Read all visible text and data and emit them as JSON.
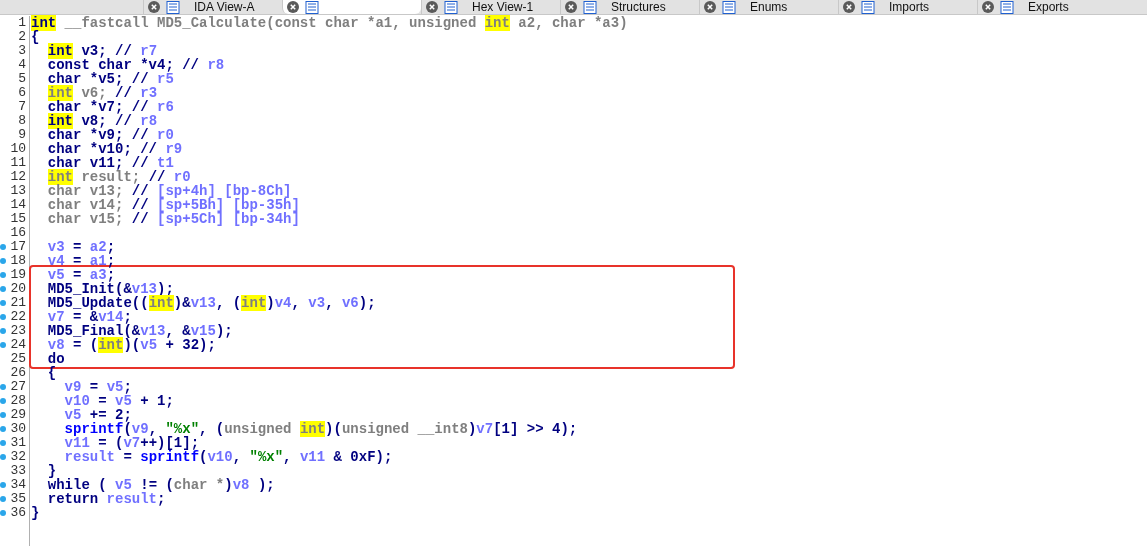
{
  "tabs": [
    {
      "label": "IDA View-A",
      "selected": false
    },
    {
      "selected": true
    },
    {
      "label": "Hex View-1",
      "selected": false
    },
    {
      "label": "Structures",
      "selected": false
    },
    {
      "label": "Enums",
      "selected": false
    },
    {
      "label": "Imports",
      "selected": false
    },
    {
      "label": "Exports",
      "selected": false
    }
  ],
  "code_lines": [
    {
      "number": "1",
      "breakpoint": false,
      "boxed": false,
      "segments": [
        {
          "kind": "hl",
          "text": "int"
        },
        {
          "kind": "dim",
          "text": " __fastcall MD5_Calculate(const char *a1, unsigned "
        },
        {
          "kind": "hldim",
          "text": "int"
        },
        {
          "kind": "dim",
          "text": " a2, char *a3)"
        }
      ]
    },
    {
      "number": "2",
      "breakpoint": false,
      "boxed": false,
      "segments": [
        {
          "kind": "code",
          "text": "{"
        }
      ],
      "children": [
        {
          "number": "3",
          "breakpoint": false,
          "boxed": false,
          "segments": [
            {
              "kind": "hl",
              "text": "int"
            },
            {
              "kind": "code",
              "text": " v3; // "
            },
            {
              "kind": "var",
              "text": "r7"
            }
          ]
        },
        {
          "number": "4",
          "breakpoint": false,
          "boxed": false,
          "segments": [
            {
              "kind": "code",
              "text": "const char *v4; // "
            },
            {
              "kind": "var",
              "text": "r8"
            }
          ]
        },
        {
          "number": "5",
          "breakpoint": false,
          "boxed": false,
          "segments": [
            {
              "kind": "code",
              "text": "char *v5; // "
            },
            {
              "kind": "var",
              "text": "r5"
            }
          ]
        },
        {
          "number": "6",
          "breakpoint": false,
          "boxed": false,
          "segments": [
            {
              "kind": "hldim",
              "text": "int"
            },
            {
              "kind": "dim",
              "text": " v6; "
            },
            {
              "kind": "code",
              "text": "// "
            },
            {
              "kind": "var",
              "text": "r3"
            }
          ]
        },
        {
          "number": "7",
          "breakpoint": false,
          "boxed": false,
          "segments": [
            {
              "kind": "code",
              "text": "char *v7; // "
            },
            {
              "kind": "var",
              "text": "r6"
            }
          ]
        },
        {
          "number": "8",
          "breakpoint": false,
          "boxed": false,
          "segments": [
            {
              "kind": "hl",
              "text": "int"
            },
            {
              "kind": "code",
              "text": " v8; // "
            },
            {
              "kind": "var",
              "text": "r8"
            }
          ]
        },
        {
          "number": "9",
          "breakpoint": false,
          "boxed": false,
          "segments": [
            {
              "kind": "code",
              "text": "char *v9; // "
            },
            {
              "kind": "var",
              "text": "r0"
            }
          ]
        },
        {
          "number": "10",
          "breakpoint": false,
          "boxed": false,
          "segments": [
            {
              "kind": "code",
              "text": "char *v10; // "
            },
            {
              "kind": "var",
              "text": "r9"
            }
          ]
        },
        {
          "number": "11",
          "breakpoint": false,
          "boxed": false,
          "segments": [
            {
              "kind": "code",
              "text": "char v11; // "
            },
            {
              "kind": "var",
              "text": "t1"
            }
          ]
        },
        {
          "number": "12",
          "breakpoint": false,
          "boxed": false,
          "segments": [
            {
              "kind": "hldim",
              "text": "int"
            },
            {
              "kind": "dim",
              "text": " result; "
            },
            {
              "kind": "code",
              "text": "// "
            },
            {
              "kind": "var",
              "text": "r0"
            }
          ]
        },
        {
          "number": "13",
          "breakpoint": false,
          "boxed": false,
          "segments": [
            {
              "kind": "dim",
              "text": "char v13; "
            },
            {
              "kind": "code",
              "text": "// "
            },
            {
              "kind": "var",
              "text": "[sp+4h] [bp-8Ch]"
            }
          ]
        },
        {
          "number": "14",
          "breakpoint": false,
          "boxed": false,
          "segments": [
            {
              "kind": "dim",
              "text": "char v14; "
            },
            {
              "kind": "code",
              "text": "// "
            },
            {
              "kind": "var",
              "text": "[sp+5Bh] [bp-35h]"
            }
          ]
        },
        {
          "number": "15",
          "breakpoint": false,
          "boxed": false,
          "segments": [
            {
              "kind": "dim",
              "text": "char v15; "
            },
            {
              "kind": "code",
              "text": "// "
            },
            {
              "kind": "var",
              "text": "[sp+5Ch] [bp-34h]"
            }
          ]
        },
        {
          "number": "16",
          "breakpoint": false,
          "boxed": false
        },
        {
          "number": "17",
          "breakpoint": true,
          "boxed": false,
          "segments": [
            {
              "kind": "var",
              "text": "v3"
            },
            {
              "kind": "code",
              "text": " = "
            },
            {
              "kind": "var",
              "text": "a2"
            },
            {
              "kind": "code",
              "text": ";"
            }
          ]
        },
        {
          "number": "18",
          "breakpoint": true,
          "boxed": false,
          "segments": [
            {
              "kind": "var",
              "text": "v4"
            },
            {
              "kind": "code",
              "text": " = "
            },
            {
              "kind": "var",
              "text": "a1"
            },
            {
              "kind": "code",
              "text": ";"
            }
          ]
        },
        {
          "number": "19",
          "breakpoint": true,
          "boxed": true,
          "segments": [
            {
              "kind": "var",
              "text": "v5"
            },
            {
              "kind": "code",
              "text": " = "
            },
            {
              "kind": "var",
              "text": "a3"
            },
            {
              "kind": "code",
              "text": ";"
            }
          ]
        },
        {
          "number": "20",
          "breakpoint": true,
          "boxed": true,
          "segments": [
            {
              "kind": "code",
              "text": "MD5_Init(&"
            },
            {
              "kind": "var",
              "text": "v13"
            },
            {
              "kind": "code",
              "text": ");"
            }
          ]
        },
        {
          "number": "21",
          "breakpoint": true,
          "boxed": true,
          "segments": [
            {
              "kind": "code",
              "text": "MD5_Update(("
            },
            {
              "kind": "hldim",
              "text": "int"
            },
            {
              "kind": "code",
              "text": ")&"
            },
            {
              "kind": "var",
              "text": "v13"
            },
            {
              "kind": "code",
              "text": ", ("
            },
            {
              "kind": "hldim",
              "text": "int"
            },
            {
              "kind": "code",
              "text": ")"
            },
            {
              "kind": "var",
              "text": "v4"
            },
            {
              "kind": "code",
              "text": ", "
            },
            {
              "kind": "var",
              "text": "v3"
            },
            {
              "kind": "code",
              "text": ", "
            },
            {
              "kind": "var",
              "text": "v6"
            },
            {
              "kind": "code",
              "text": ");"
            }
          ]
        },
        {
          "number": "22",
          "breakpoint": true,
          "boxed": true,
          "segments": [
            {
              "kind": "var",
              "text": "v7"
            },
            {
              "kind": "code",
              "text": " = &"
            },
            {
              "kind": "var",
              "text": "v14"
            },
            {
              "kind": "code",
              "text": ";"
            }
          ]
        },
        {
          "number": "23",
          "breakpoint": true,
          "boxed": true,
          "segments": [
            {
              "kind": "code",
              "text": "MD5_Final(&"
            },
            {
              "kind": "var",
              "text": "v13"
            },
            {
              "kind": "code",
              "text": ", &"
            },
            {
              "kind": "var",
              "text": "v15"
            },
            {
              "kind": "code",
              "text": ");"
            }
          ]
        },
        {
          "number": "24",
          "breakpoint": true,
          "boxed": true,
          "segments": [
            {
              "kind": "var",
              "text": "v8"
            },
            {
              "kind": "code",
              "text": " = ("
            },
            {
              "kind": "hldim",
              "text": "int"
            },
            {
              "kind": "code",
              "text": ")("
            },
            {
              "kind": "var",
              "text": "v5"
            },
            {
              "kind": "code",
              "text": " + 32);"
            }
          ]
        },
        {
          "number": "25",
          "breakpoint": false,
          "boxed": true,
          "segments": [
            {
              "kind": "code",
              "text": "do"
            }
          ]
        },
        {
          "number": "26",
          "breakpoint": false,
          "boxed": false,
          "segments": [
            {
              "kind": "code",
              "text": "{"
            }
          ],
          "children": [
            {
              "number": "27",
              "breakpoint": true,
              "boxed": false,
              "segments": [
                {
                  "kind": "var",
                  "text": "v9"
                },
                {
                  "kind": "code",
                  "text": " = "
                },
                {
                  "kind": "var",
                  "text": "v5"
                },
                {
                  "kind": "code",
                  "text": ";"
                }
              ]
            },
            {
              "number": "28",
              "breakpoint": true,
              "boxed": false,
              "segments": [
                {
                  "kind": "var",
                  "text": "v10"
                },
                {
                  "kind": "code",
                  "text": " = "
                },
                {
                  "kind": "var",
                  "text": "v5"
                },
                {
                  "kind": "code",
                  "text": " + 1;"
                }
              ]
            },
            {
              "number": "29",
              "breakpoint": true,
              "boxed": false,
              "segments": [
                {
                  "kind": "var",
                  "text": "v5"
                },
                {
                  "kind": "code",
                  "text": " += 2;"
                }
              ]
            },
            {
              "number": "30",
              "breakpoint": true,
              "boxed": false,
              "segments": [
                {
                  "kind": "func",
                  "text": "sprintf"
                },
                {
                  "kind": "code",
                  "text": "("
                },
                {
                  "kind": "var",
                  "text": "v9"
                },
                {
                  "kind": "code",
                  "text": ", "
                },
                {
                  "kind": "str",
                  "text": "\"%x\""
                },
                {
                  "kind": "code",
                  "text": ", ("
                },
                {
                  "kind": "dim",
                  "text": "unsigned "
                },
                {
                  "kind": "hldim",
                  "text": "int"
                },
                {
                  "kind": "code",
                  "text": ")("
                },
                {
                  "kind": "dim",
                  "text": "unsigned __int8"
                },
                {
                  "kind": "code",
                  "text": ")"
                },
                {
                  "kind": "var",
                  "text": "v7"
                },
                {
                  "kind": "code",
                  "text": "[1] >> 4);"
                }
              ]
            },
            {
              "number": "31",
              "breakpoint": true,
              "boxed": false,
              "segments": [
                {
                  "kind": "var",
                  "text": "v11"
                },
                {
                  "kind": "code",
                  "text": " = ("
                },
                {
                  "kind": "var",
                  "text": "v7"
                },
                {
                  "kind": "code",
                  "text": "++)[1];"
                }
              ]
            },
            {
              "number": "32",
              "breakpoint": true,
              "boxed": false,
              "segments": [
                {
                  "kind": "var",
                  "text": "result"
                },
                {
                  "kind": "code",
                  "text": " = "
                },
                {
                  "kind": "func",
                  "text": "sprintf"
                },
                {
                  "kind": "code",
                  "text": "("
                },
                {
                  "kind": "var",
                  "text": "v10"
                },
                {
                  "kind": "code",
                  "text": ", "
                },
                {
                  "kind": "str",
                  "text": "\"%x\""
                },
                {
                  "kind": "code",
                  "text": ", "
                },
                {
                  "kind": "var",
                  "text": "v11"
                },
                {
                  "kind": "code",
                  "text": " & 0xF);"
                }
              ]
            }
          ]
        },
        {
          "number": "33",
          "breakpoint": false,
          "boxed": false,
          "segments": [
            {
              "kind": "code",
              "text": "}"
            }
          ]
        },
        {
          "number": "34",
          "breakpoint": true,
          "boxed": false,
          "segments": [
            {
              "kind": "code",
              "text": "while ( "
            },
            {
              "kind": "var",
              "text": "v5"
            },
            {
              "kind": "code",
              "text": " != ("
            },
            {
              "kind": "dim",
              "text": "char *"
            },
            {
              "kind": "code",
              "text": ")"
            },
            {
              "kind": "var",
              "text": "v8"
            },
            {
              "kind": "code",
              "text": " );"
            }
          ]
        },
        {
          "number": "35",
          "breakpoint": true,
          "boxed": false,
          "segments": [
            {
              "kind": "code",
              "text": "return "
            },
            {
              "kind": "var",
              "text": "result"
            },
            {
              "kind": "code",
              "text": ";"
            }
          ]
        }
      ]
    },
    {
      "number": "36",
      "breakpoint": true,
      "boxed": false,
      "segments": [
        {
          "kind": "code",
          "text": "}"
        }
      ]
    }
  ]
}
